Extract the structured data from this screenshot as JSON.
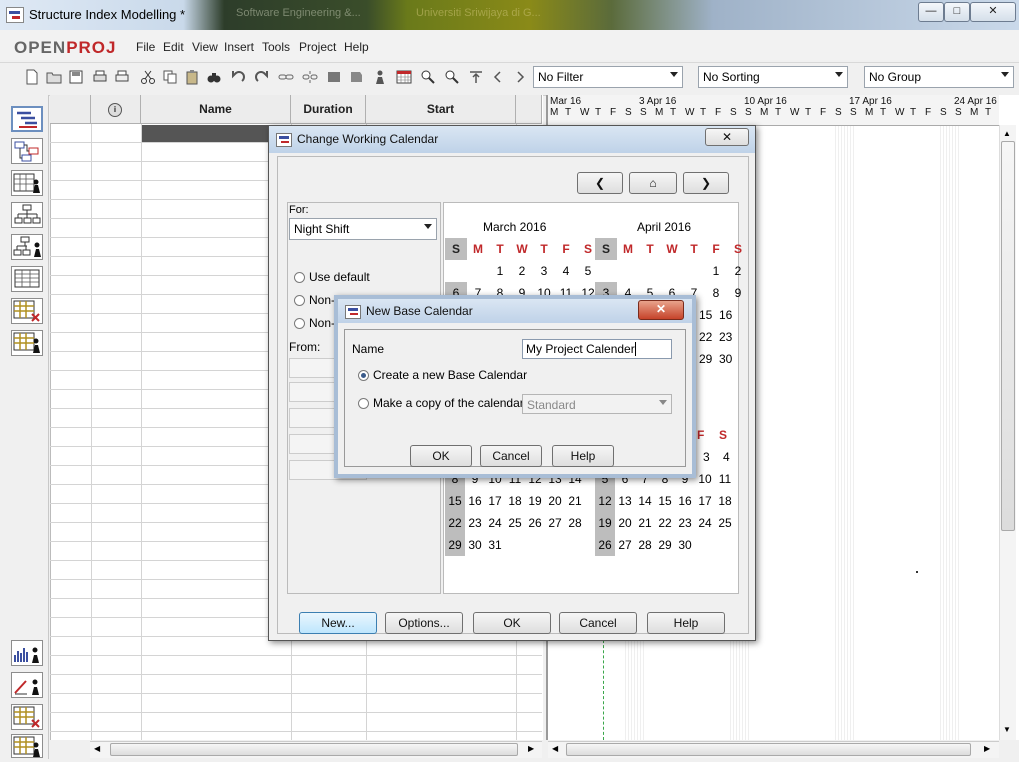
{
  "window": {
    "title": "Structure Index Modelling *",
    "bg_tabs": [
      "Software Engineering &...",
      "Universiti Sriwijaya di G..."
    ]
  },
  "logo": {
    "open": "OPEN",
    "proj": "PROJ"
  },
  "menu": [
    "File",
    "Edit",
    "View",
    "Insert",
    "Tools",
    "Project",
    "Help"
  ],
  "toolbar": {
    "filter": "No Filter",
    "sorting": "No Sorting",
    "group": "No Group"
  },
  "table": {
    "columns": [
      "",
      "Name",
      "Duration",
      "Start"
    ]
  },
  "gantt": {
    "weeks": [
      "Mar 16",
      "3 Apr 16",
      "10 Apr 16",
      "17 Apr 16",
      "24 Apr 16"
    ],
    "day_letters": [
      "M",
      "T",
      "W",
      "T",
      "F",
      "S",
      "S"
    ]
  },
  "calendar_dialog": {
    "title": "Change Working Calendar",
    "for_label": "For:",
    "for_value": "Night Shift",
    "options": [
      "Use default",
      "Non-working time",
      "Non-default working time"
    ],
    "options_visible": [
      "Use default",
      "Non-",
      "Non-"
    ],
    "from_label": "From:",
    "months": [
      {
        "title": "March 2016",
        "weeks": [
          [
            "",
            "",
            "1",
            "2",
            "3",
            "4",
            "5"
          ],
          [
            "6",
            "7",
            "8",
            "9",
            "10",
            "11",
            "12"
          ]
        ]
      },
      {
        "title": "April 2016",
        "weeks": [
          [
            "",
            "",
            "",
            "",
            "",
            "1",
            "2"
          ],
          [
            "3",
            "4",
            "5",
            "6",
            "7",
            "8",
            "9"
          ]
        ]
      }
    ],
    "weekday_headers": [
      "S",
      "M",
      "T",
      "W",
      "T",
      "F",
      "S"
    ],
    "partial_rows_right": [
      [
        "15",
        "16"
      ],
      [
        "22",
        "23"
      ],
      [
        "29",
        "30"
      ]
    ],
    "may_partial_header": [
      "F",
      "S"
    ],
    "lower_left": [
      [
        "8",
        "9",
        "10",
        "11",
        "12",
        "13",
        "14"
      ],
      [
        "15",
        "16",
        "17",
        "18",
        "19",
        "20",
        "21"
      ],
      [
        "22",
        "23",
        "24",
        "25",
        "26",
        "27",
        "28"
      ],
      [
        "29",
        "30",
        "31",
        "",
        "",
        "",
        ""
      ]
    ],
    "lower_right_top": [
      "3",
      "4"
    ],
    "lower_right": [
      [
        "5",
        "6",
        "7",
        "8",
        "9",
        "10",
        "11"
      ],
      [
        "12",
        "13",
        "14",
        "15",
        "16",
        "17",
        "18"
      ],
      [
        "19",
        "20",
        "21",
        "22",
        "23",
        "24",
        "25"
      ],
      [
        "26",
        "27",
        "28",
        "29",
        "30",
        "",
        ""
      ]
    ],
    "buttons": {
      "new": "New...",
      "options": "Options...",
      "ok": "OK",
      "cancel": "Cancel",
      "help": "Help"
    }
  },
  "base_dialog": {
    "title": "New Base Calendar",
    "name_label": "Name",
    "name_value": "My Project Calender",
    "radio_create": "Create a new Base Calendar",
    "radio_copy": "Make a copy of the calendar",
    "copy_value": "Standard",
    "buttons": {
      "ok": "OK",
      "cancel": "Cancel",
      "help": "Help"
    }
  },
  "colors": {
    "accent_red": "#c0282a",
    "weekend_gray": "#bdbdbd"
  }
}
